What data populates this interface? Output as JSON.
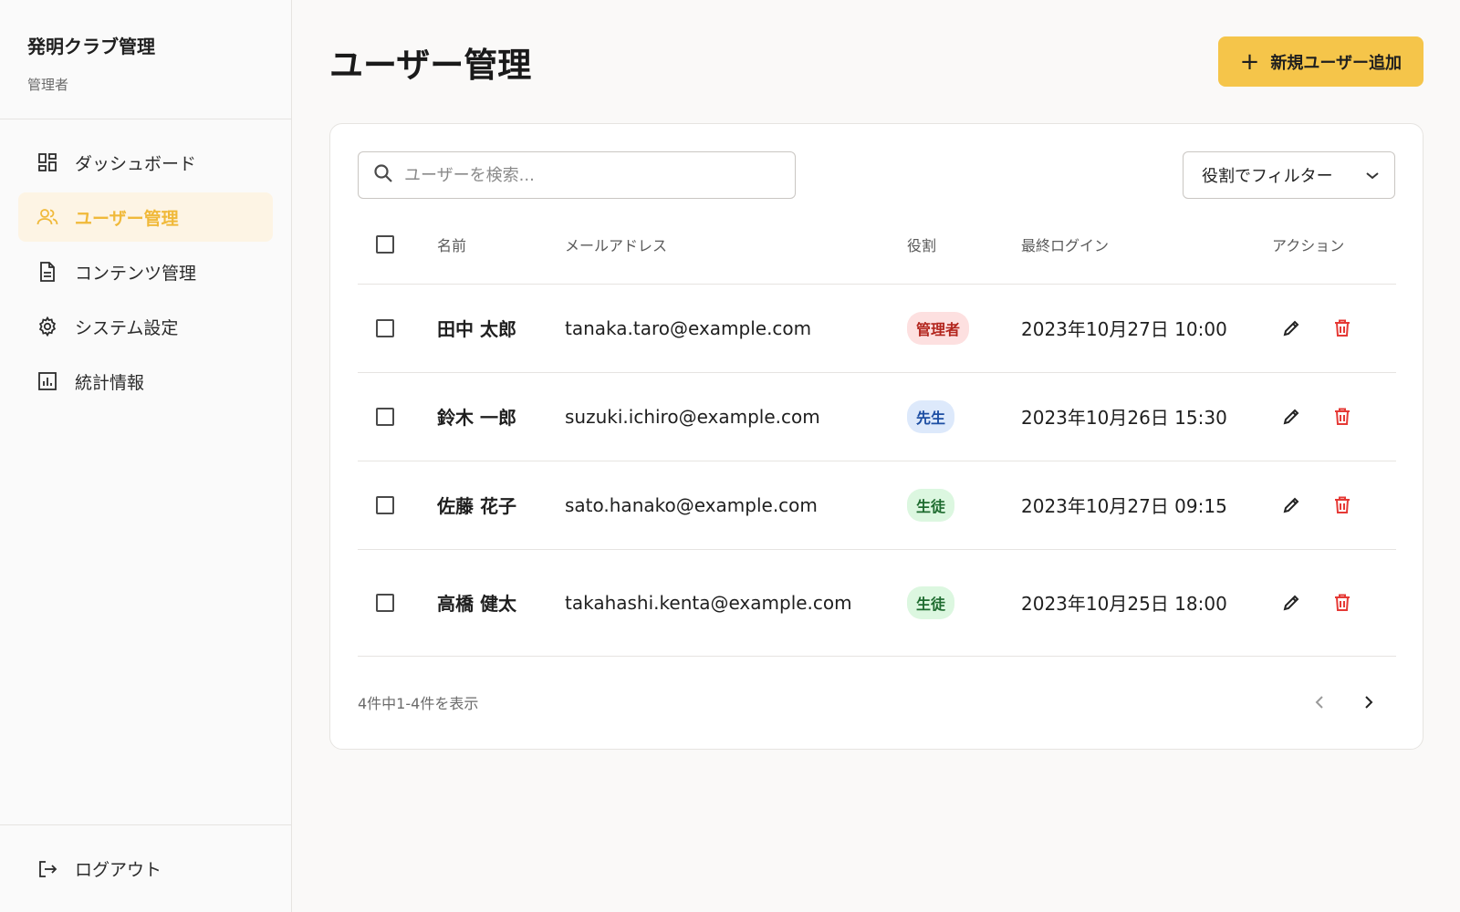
{
  "sidebar": {
    "brand_title": "発明クラブ管理",
    "brand_role": "管理者",
    "items": [
      {
        "label": "ダッシュボード",
        "icon": "dashboard-grid-icon"
      },
      {
        "label": "ユーザー管理",
        "icon": "users-icon",
        "active": true
      },
      {
        "label": "コンテンツ管理",
        "icon": "document-icon"
      },
      {
        "label": "システム設定",
        "icon": "gear-icon"
      },
      {
        "label": "統計情報",
        "icon": "bar-chart-icon"
      }
    ],
    "logout_label": "ログアウト"
  },
  "header": {
    "title": "ユーザー管理",
    "add_button_label": "新規ユーザー追加"
  },
  "toolbar": {
    "search_placeholder": "ユーザーを検索...",
    "filter_label": "役割でフィルター"
  },
  "table": {
    "headers": {
      "name": "名前",
      "email": "メールアドレス",
      "role": "役割",
      "last_login": "最終ログイン",
      "actions": "アクション"
    },
    "rows": [
      {
        "name": "田中 太郎",
        "email": "tanaka.taro@example.com",
        "role": "管理者",
        "last_login": "2023年10月27日 10:00"
      },
      {
        "name": "鈴木 一郎",
        "email": "suzuki.ichiro@example.com",
        "role": "先生",
        "last_login": "2023年10月26日 15:30"
      },
      {
        "name": "佐藤 花子",
        "email": "sato.hanako@example.com",
        "role": "生徒",
        "last_login": "2023年10月27日 09:15"
      },
      {
        "name": "高橋 健太",
        "email": "takahashi.kenta@example.com",
        "role": "生徒",
        "last_login": "2023年10月25日 18:00"
      }
    ]
  },
  "pagination": {
    "info": "4件中1-4件を表示"
  },
  "colors": {
    "accent": "#f5c54a",
    "active_text": "#f0b93a",
    "active_bg": "#fdf4e4",
    "badge_admin_bg": "#fde0e0",
    "badge_admin_text": "#b3261e",
    "badge_teacher_bg": "#dde9fb",
    "badge_teacher_text": "#1d4ea3",
    "badge_student_bg": "#dcf7e0",
    "badge_student_text": "#1e6b2f",
    "delete_red": "#e53935"
  }
}
